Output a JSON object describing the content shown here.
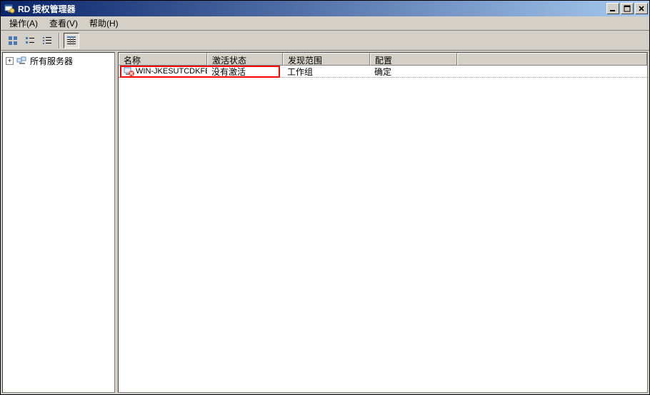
{
  "window": {
    "title": "RD 授权管理器"
  },
  "menu": {
    "action": "操作(A)",
    "view": "查看(V)",
    "help": "帮助(H)"
  },
  "tree": {
    "root": "所有服务器"
  },
  "columns": {
    "name": "名称",
    "activation": "激活状态",
    "scope": "发现范围",
    "config": "配置"
  },
  "rows": [
    {
      "name": "WIN-JKESUTCDKFE",
      "activation": "没有激活",
      "scope": "工作组",
      "config": "确定"
    }
  ]
}
